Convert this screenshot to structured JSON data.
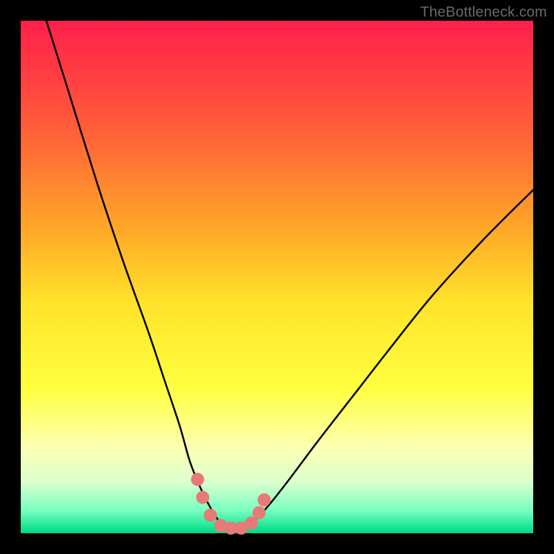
{
  "watermark": "TheBottleneck.com",
  "chart_data": {
    "type": "line",
    "title": "",
    "xlabel": "",
    "ylabel": "",
    "xlim": [
      0,
      100
    ],
    "ylim": [
      0,
      100
    ],
    "grid": false,
    "legend": false,
    "gradient_stops": [
      {
        "pos": 0.0,
        "color": "#ff1f4b"
      },
      {
        "pos": 0.2,
        "color": "#ff5a3a"
      },
      {
        "pos": 0.4,
        "color": "#ffa528"
      },
      {
        "pos": 0.55,
        "color": "#ffe32a"
      },
      {
        "pos": 0.72,
        "color": "#ffff40"
      },
      {
        "pos": 0.83,
        "color": "#fdffb0"
      },
      {
        "pos": 0.9,
        "color": "#dbffce"
      },
      {
        "pos": 0.955,
        "color": "#7affc0"
      },
      {
        "pos": 0.985,
        "color": "#22e89a"
      },
      {
        "pos": 1.0,
        "color": "#00d884"
      }
    ],
    "series": [
      {
        "name": "bottleneck-curve",
        "color": "#000000",
        "x": [
          5,
          10,
          15,
          20,
          25,
          28,
          31,
          33,
          35,
          37,
          39,
          41,
          43,
          45,
          48,
          52,
          58,
          65,
          72,
          80,
          90,
          100
        ],
        "y": [
          100,
          84,
          68,
          53,
          39,
          30,
          21,
          14,
          9,
          5,
          2,
          1,
          1,
          2,
          5,
          10,
          18,
          27,
          36,
          46,
          57,
          67
        ]
      },
      {
        "name": "highlight-markers",
        "color": "#e77a77",
        "type": "scatter",
        "x": [
          34.5,
          35.5,
          37.0,
          39.0,
          41.0,
          43.0,
          45.0,
          46.5,
          47.5
        ],
        "y": [
          10.5,
          7.0,
          3.5,
          1.5,
          1.0,
          1.0,
          2.0,
          4.0,
          6.5
        ]
      }
    ],
    "annotations": []
  }
}
